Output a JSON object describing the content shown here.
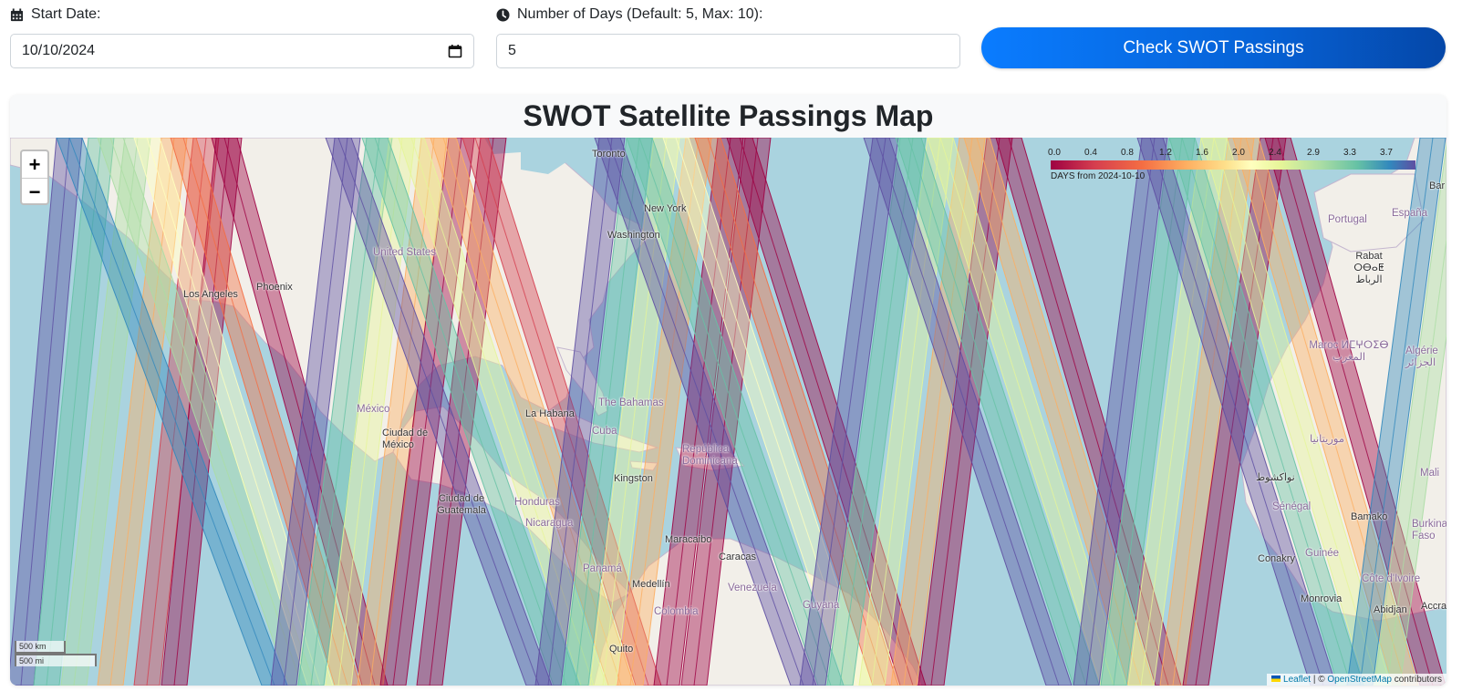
{
  "form": {
    "start_date_label": "Start Date:",
    "start_date_value": "10/10/2024",
    "days_label": "Number of Days (Default: 5, Max: 10):",
    "days_value": "5",
    "submit_label": "Check SWOT Passings"
  },
  "map": {
    "title": "SWOT Satellite Passings Map",
    "zoom_in": "+",
    "zoom_out": "−",
    "legend": {
      "ticks": [
        "0.0",
        "0.4",
        "0.8",
        "1.2",
        "1.6",
        "2.0",
        "2.4",
        "2.9",
        "3.3",
        "3.7"
      ],
      "caption": "DAYS from 2024-10-10",
      "colors": [
        "#9e0142",
        "#d53e4f",
        "#f46d43",
        "#fdae61",
        "#fee08b",
        "#ffffbf",
        "#e6f598",
        "#abdda4",
        "#66c2a5",
        "#3288bd",
        "#5e4fa2"
      ]
    },
    "places": {
      "toronto": "Toronto",
      "new_york": "New York",
      "washington": "Washington",
      "united_states": "United States",
      "phoenix": "Phoenix",
      "los_angeles": "Los Angeles",
      "mexico": "México",
      "ciudad_de_mexico": "Ciudad de México",
      "la_habana": "La Habana",
      "bahamas": "The Bahamas",
      "cuba": "Cuba",
      "republica_dominicana": "República Dominicana",
      "kingston": "Kingston",
      "ciudad_de_guatemala": "Ciudad de Guatemala",
      "honduras": "Honduras",
      "nicaragua": "Nicaragua",
      "panama": "Panamá",
      "maracaibo": "Maracaibo",
      "caracas": "Caracas",
      "medellin": "Medellín",
      "venezuela": "Venezuela",
      "colombia": "Colombia",
      "guyana": "Guyana",
      "quito": "Quito",
      "portugal": "Portugal",
      "espana": "España",
      "rabat": "Rabat ⵔⴱⴰⵟ الرباط",
      "maroc": "Maroc ⵍⵎⵖⵔⵉⴱ المغرب",
      "algerie": "Algérie الجزائر",
      "mauritanie": "موريتانيا",
      "nouakchott": "نواكشوط",
      "senegal": "Sénégal",
      "mali": "Mali",
      "bamako": "Bamako",
      "burkina": "Burkina Faso",
      "conakry": "Conakry",
      "guinee": "Guinée",
      "cote_divoire": "Côte d'Ivoire",
      "monrovia": "Monrovia",
      "abidjan": "Abidjan",
      "accra": "Accra",
      "bar": "Bar"
    },
    "scale": {
      "km": "500 km",
      "mi": "500 mi"
    },
    "attribution": {
      "leaflet": "Leaflet",
      "sep": " | © ",
      "osm": "OpenStreetMap",
      "rest": " contributors"
    }
  }
}
